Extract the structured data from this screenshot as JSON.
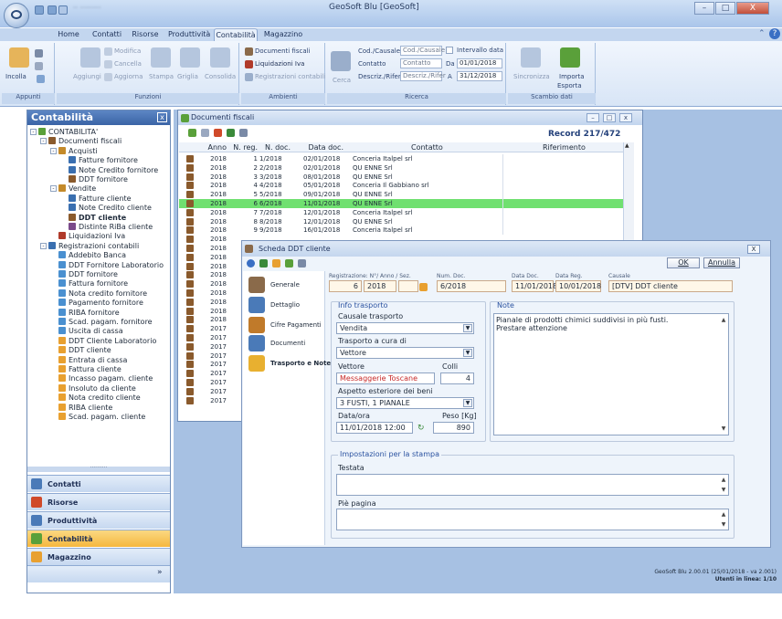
{
  "app": {
    "title": "GeoSoft Blu [GeoSoft]",
    "blurred_doc_name": "·· ·········",
    "window_controls": {
      "minimize": "–",
      "maximize": "□",
      "close": "X"
    },
    "help": "?"
  },
  "ribbon": {
    "tabs": [
      {
        "label": "Home"
      },
      {
        "label": "Contatti"
      },
      {
        "label": "Risorse"
      },
      {
        "label": "Produttività"
      },
      {
        "label": "Contabilità"
      },
      {
        "label": "Magazzino"
      }
    ],
    "active_tab": "Contabilità",
    "groups": {
      "appunti": {
        "label": "Appunti",
        "incolla": "Incolla"
      },
      "funzioni": {
        "label": "Funzioni",
        "aggiungi": "Aggiungi",
        "modifica": "Modifica",
        "cancella": "Cancella",
        "aggiorna": "Aggiorna",
        "stampa": "Stampa",
        "griglia": "Griglia",
        "consolida": "Consolida"
      },
      "ambienti": {
        "label": "Ambienti",
        "documenti_fiscali": "Documenti fiscali",
        "liquidazioni_iva": "Liquidazioni Iva",
        "registrazioni_contabili": "Registrazioni contabili"
      },
      "ricerca": {
        "label": "Ricerca",
        "cerca": "Cerca",
        "cod_causale_label": "Cod./Causale",
        "cod_causale_placeholder": "Cod./Causale",
        "contatto_label": "Contatto",
        "contatto_placeholder": "Contatto",
        "descriz_label": "Descriz./Rifer.",
        "descriz_placeholder": "Descriz./Rifer",
        "intervallo_label": "Intervallo data",
        "da_label": "Da",
        "da_value": "01/01/2018",
        "a_label": "A",
        "a_value": "31/12/2018"
      },
      "scambio": {
        "label": "Scambio dati",
        "sincronizza": "Sincronizza",
        "importa": "Importa",
        "esporta": "Esporta"
      }
    }
  },
  "left_pane": {
    "title": "Contabilità",
    "close": "x",
    "tree": [
      {
        "label": "CONTABILITA'",
        "level": 0,
        "expander": "-",
        "color": "#5aa03a"
      },
      {
        "label": "Documenti fiscali",
        "level": 1,
        "expander": "-",
        "color": "#8a5a2c"
      },
      {
        "label": "Acquisti",
        "level": 2,
        "expander": "-",
        "color": "#c48a2a"
      },
      {
        "label": "Fatture fornitore",
        "level": 3,
        "color": "#3a6fb0"
      },
      {
        "label": "Note Credito fornitore",
        "level": 3,
        "color": "#3a6fb0"
      },
      {
        "label": "DDT fornitore",
        "level": 3,
        "color": "#8a5a2c"
      },
      {
        "label": "Vendite",
        "level": 2,
        "expander": "-",
        "color": "#c48a2a"
      },
      {
        "label": "Fatture cliente",
        "level": 3,
        "color": "#3a6fb0"
      },
      {
        "label": "Note Credito cliente",
        "level": 3,
        "color": "#3a6fb0"
      },
      {
        "label": "DDT cliente",
        "level": 3,
        "color": "#8a5a2c",
        "bold": true
      },
      {
        "label": "Distinte RiBa cliente",
        "level": 3,
        "color": "#7a4a8a"
      },
      {
        "label": "Liquidazioni Iva",
        "level": 2,
        "color": "#b03a2a"
      },
      {
        "label": "Registrazioni contabili",
        "level": 1,
        "expander": "-",
        "color": "#3a6fb0"
      },
      {
        "label": "Addebito Banca",
        "level": 2,
        "color": "#4a90d0"
      },
      {
        "label": "DDT Fornitore Laboratorio",
        "level": 2,
        "color": "#4a90d0"
      },
      {
        "label": "DDT fornitore",
        "level": 2,
        "color": "#4a90d0"
      },
      {
        "label": "Fattura fornitore",
        "level": 2,
        "color": "#4a90d0"
      },
      {
        "label": "Nota credito fornitore",
        "level": 2,
        "color": "#4a90d0"
      },
      {
        "label": "Pagamento fornitore",
        "level": 2,
        "color": "#4a90d0"
      },
      {
        "label": "RIBA fornitore",
        "level": 2,
        "color": "#4a90d0"
      },
      {
        "label": "Scad. pagam. fornitore",
        "level": 2,
        "color": "#4a90d0"
      },
      {
        "label": "Uscita di cassa",
        "level": 2,
        "color": "#4a90d0"
      },
      {
        "label": "DDT Cliente Laboratorio",
        "level": 2,
        "color": "#e8a030"
      },
      {
        "label": "DDT cliente",
        "level": 2,
        "color": "#e8a030"
      },
      {
        "label": "Entrata di cassa",
        "level": 2,
        "color": "#e8a030"
      },
      {
        "label": "Fattura cliente",
        "level": 2,
        "color": "#e8a030"
      },
      {
        "label": "Incasso pagam. cliente",
        "level": 2,
        "color": "#e8a030"
      },
      {
        "label": "Insoluto da cliente",
        "level": 2,
        "color": "#e8a030"
      },
      {
        "label": "Nota credito cliente",
        "level": 2,
        "color": "#e8a030"
      },
      {
        "label": "RIBA cliente",
        "level": 2,
        "color": "#e8a030"
      },
      {
        "label": "Scad. pagam. cliente",
        "level": 2,
        "color": "#e8a030"
      }
    ],
    "nav_buttons": [
      {
        "label": "Contatti",
        "color": "#4a7ab8"
      },
      {
        "label": "Risorse",
        "color": "#d04a2a"
      },
      {
        "label": "Produttività",
        "color": "#4a7ab8"
      },
      {
        "label": "Contabilità",
        "color": "#5aa03a",
        "active": true
      },
      {
        "label": "Magazzino",
        "color": "#e8a030"
      }
    ],
    "splitter_dots": "··········",
    "more": "»"
  },
  "documents_window": {
    "title": "Documenti fiscali",
    "record": "Record 217/472",
    "columns": [
      "Anno",
      "N. reg.",
      "N. doc.",
      "Data doc.",
      "Contatto",
      "Riferimento"
    ],
    "rows": [
      {
        "anno": "2018",
        "nreg": "1",
        "ndoc": "1/2018",
        "data": "02/01/2018",
        "contatto": "Conceria Italpel srl"
      },
      {
        "anno": "2018",
        "nreg": "2",
        "ndoc": "2/2018",
        "data": "02/01/2018",
        "contatto": "QU ENNE Srl"
      },
      {
        "anno": "2018",
        "nreg": "3",
        "ndoc": "3/2018",
        "data": "08/01/2018",
        "contatto": "QU ENNE Srl"
      },
      {
        "anno": "2018",
        "nreg": "4",
        "ndoc": "4/2018",
        "data": "05/01/2018",
        "contatto": "Conceria Il Gabbiano srl"
      },
      {
        "anno": "2018",
        "nreg": "5",
        "ndoc": "5/2018",
        "data": "09/01/2018",
        "contatto": "QU ENNE Srl"
      },
      {
        "anno": "2018",
        "nreg": "6",
        "ndoc": "6/2018",
        "data": "11/01/2018",
        "contatto": "QU ENNE Srl",
        "selected": true
      },
      {
        "anno": "2018",
        "nreg": "7",
        "ndoc": "7/2018",
        "data": "12/01/2018",
        "contatto": "Conceria Italpel srl"
      },
      {
        "anno": "2018",
        "nreg": "8",
        "ndoc": "8/2018",
        "data": "12/01/2018",
        "contatto": "QU ENNE Srl"
      },
      {
        "anno": "2018",
        "nreg": "9",
        "ndoc": "9/2018",
        "data": "16/01/2018",
        "contatto": "Conceria Italpel srl"
      },
      {
        "anno": "2018"
      },
      {
        "anno": "2018"
      },
      {
        "anno": "2018"
      },
      {
        "anno": "2018"
      },
      {
        "anno": "2018"
      },
      {
        "anno": "2018"
      },
      {
        "anno": "2018"
      },
      {
        "anno": "2018"
      },
      {
        "anno": "2018"
      },
      {
        "anno": "2018"
      },
      {
        "anno": "2017"
      },
      {
        "anno": "2017"
      },
      {
        "anno": "2017"
      },
      {
        "anno": "2017"
      },
      {
        "anno": "2017"
      },
      {
        "anno": "2017"
      },
      {
        "anno": "2017"
      },
      {
        "anno": "2017"
      },
      {
        "anno": "2017"
      }
    ]
  },
  "scheda": {
    "title": "Scheda DDT cliente",
    "close": "X",
    "ok": "OK",
    "annulla": "Annulla",
    "nav": [
      {
        "label": "Generale",
        "color": "#8a6a4a"
      },
      {
        "label": "Dettaglio",
        "color": "#4a7ab8"
      },
      {
        "label": "Cifre Pagamenti",
        "color": "#c07a2a"
      },
      {
        "label": "Documenti",
        "color": "#4a7ab8"
      },
      {
        "label": "Trasporto e Note",
        "color": "#e8b030",
        "active": true
      }
    ],
    "header": {
      "registrazione_label": "Registrazione: N°/ Anno / Sez.",
      "reg_num": "6",
      "reg_anno": "2018",
      "num_doc_label": "Num. Doc.",
      "num_doc": "6/2018",
      "data_doc_label": "Data Doc.",
      "data_doc": "11/01/2018",
      "data_reg_label": "Data Reg.",
      "data_reg": "10/01/2018",
      "causale_label": "Causale",
      "causale": "[DTV] DDT cliente"
    },
    "info_trasporto": {
      "title": "Info trasporto",
      "causale_trasporto_label": "Causale trasporto",
      "causale_trasporto": "Vendita",
      "trasporto_cura_label": "Trasporto a cura di",
      "trasporto_cura": "Vettore",
      "vettore_label": "Vettore",
      "vettore": "Messaggerie Toscane",
      "colli_label": "Colli",
      "colli": "4",
      "aspetto_label": "Aspetto esteriore dei beni",
      "aspetto": "3 FUSTI, 1 PIANALE",
      "dataora_label": "Data/ora",
      "dataora": "11/01/2018 12:00",
      "peso_label": "Peso [Kg]",
      "peso": "890"
    },
    "note": {
      "title": "Note",
      "text_line1": "Pianale di prodotti chimici suddivisi in più fusti.",
      "text_line2": "Prestare attenzione"
    },
    "stampa": {
      "title": "Impostazioni per la stampa",
      "testata_label": "Testata",
      "piepagina_label": "Piè pagina"
    }
  },
  "status": {
    "version": "GeoSoft Blu 2.00.01 (25/01/2018 - va 2.001)",
    "users": "Utenti in linea: 1/10"
  }
}
